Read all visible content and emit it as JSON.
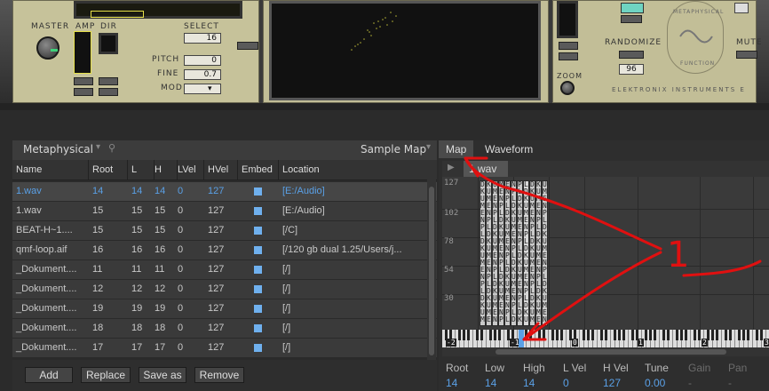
{
  "instrument": {
    "labels": {
      "master": "MASTER",
      "amp": "AMP",
      "dir": "DIR",
      "select": "SELECT",
      "pitch": "PITCH",
      "fine": "FINE",
      "mod": "MOD",
      "zoom": "ZOOM",
      "randomize": "RANDOMIZE",
      "mute": "MUTE",
      "metaphysical": "METAPHYSICAL",
      "function": "FUNCTION",
      "brand": "ELEKTRONIX INSTRUMENTS E"
    },
    "values": {
      "select": "16",
      "pitch": "0",
      "fine": "0.7",
      "randomize": "96"
    }
  },
  "browser": {
    "preset": "Metaphysical",
    "view": "Sample Map",
    "columns": [
      "Name",
      "Root",
      "L",
      "H",
      "LVel",
      "HVel",
      "Embed",
      "Location"
    ],
    "rows": [
      {
        "name": "1.wav",
        "root": "14",
        "l": "14",
        "h": "14",
        "lvel": "0",
        "hvel": "127",
        "location": "[E:/Audio]",
        "selected": true
      },
      {
        "name": "1.wav",
        "root": "15",
        "l": "15",
        "h": "15",
        "lvel": "0",
        "hvel": "127",
        "location": "[E:/Audio]"
      },
      {
        "name": "BEAT-H~1....",
        "root": "15",
        "l": "15",
        "h": "15",
        "lvel": "0",
        "hvel": "127",
        "location": "[/C]"
      },
      {
        "name": "qmf-loop.aif",
        "root": "16",
        "l": "16",
        "h": "16",
        "lvel": "0",
        "hvel": "127",
        "location": "[/120 gb dual 1.25/Users/j..."
      },
      {
        "name": "_Dokument....",
        "root": "11",
        "l": "11",
        "h": "11",
        "lvel": "0",
        "hvel": "127",
        "location": "[/]"
      },
      {
        "name": "_Dokument....",
        "root": "12",
        "l": "12",
        "h": "12",
        "lvel": "0",
        "hvel": "127",
        "location": "[/]"
      },
      {
        "name": "_Dokument....",
        "root": "19",
        "l": "19",
        "h": "19",
        "lvel": "0",
        "hvel": "127",
        "location": "[/]"
      },
      {
        "name": "_Dokument....",
        "root": "18",
        "l": "18",
        "h": "18",
        "lvel": "0",
        "hvel": "127",
        "location": "[/]"
      },
      {
        "name": "_Dokument....",
        "root": "17",
        "l": "17",
        "h": "17",
        "lvel": "0",
        "hvel": "127",
        "location": "[/]"
      }
    ],
    "buttons": {
      "add": "Add",
      "replace": "Replace",
      "save_as": "Save as",
      "remove": "Remove"
    }
  },
  "map": {
    "tabs": {
      "map": "Map",
      "waveform": "Waveform"
    },
    "sample": "1.wav",
    "velocity_labels": [
      "127",
      "102",
      "78",
      "54",
      "30"
    ],
    "octave_labels": [
      "-2",
      "-1",
      "0",
      "1",
      "2",
      "3"
    ],
    "zone_letters": [
      "D",
      "K",
      "U",
      "M",
      "E",
      "N",
      "P",
      "L"
    ],
    "annotation": "1",
    "props": {
      "labels": {
        "root": "Root",
        "low": "Low",
        "high": "High",
        "lvel": "L Vel",
        "hvel": "H Vel",
        "tune": "Tune",
        "gain": "Gain",
        "pan": "Pan"
      },
      "values": {
        "root": "14",
        "low": "14",
        "high": "14",
        "lvel": "0",
        "hvel": "127",
        "tune": "0.00",
        "gain": "-",
        "pan": "-"
      }
    }
  },
  "colors": {
    "accent": "#5aa0e6",
    "annotation": "#e01010",
    "lcd_yellow": "#e6e04a"
  }
}
